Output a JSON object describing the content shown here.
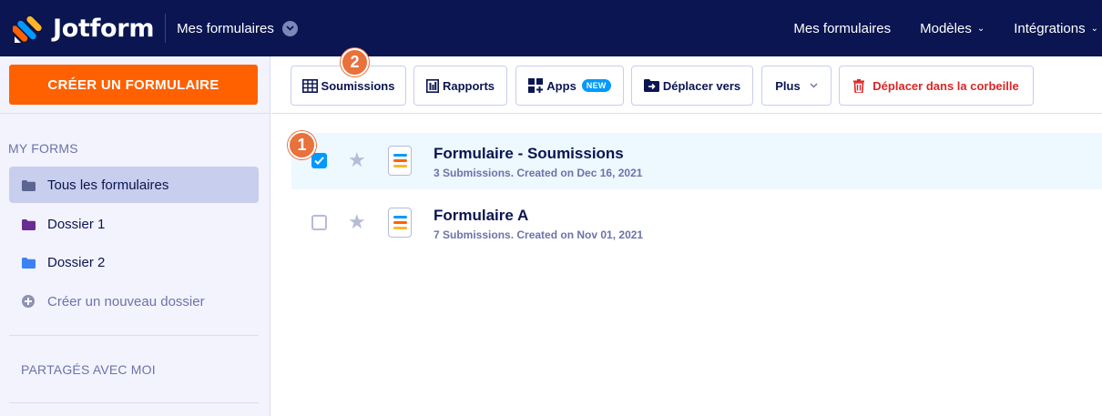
{
  "topbar": {
    "brand": "Jotform",
    "workspace_label": "Mes formulaires",
    "nav": [
      {
        "label": "Mes formulaires",
        "has_chevron": false
      },
      {
        "label": "Modèles",
        "has_chevron": true
      },
      {
        "label": "Intégrations",
        "has_chevron": true
      }
    ]
  },
  "sidebar": {
    "create_button": "CRÉER UN FORMULAIRE",
    "my_forms_title": "MY FORMS",
    "folders": [
      {
        "label": "Tous les formulaires",
        "color": "#5b6590",
        "active": true
      },
      {
        "label": "Dossier 1",
        "color": "#6a2c91",
        "active": false
      },
      {
        "label": "Dossier 2",
        "color": "#3b82f6",
        "active": false
      }
    ],
    "new_folder": "Créer un nouveau dossier",
    "shared_title": "PARTAGÉS AVEC MOI"
  },
  "toolbar": {
    "submissions": "Soumissions",
    "reports": "Rapports",
    "apps": "Apps",
    "apps_badge": "NEW",
    "move_to": "Déplacer vers",
    "more": "Plus",
    "trash": "Déplacer dans la corbeille"
  },
  "steps": {
    "step1": "1",
    "step2": "2"
  },
  "forms": [
    {
      "title": "Formulaire - Soumissions",
      "meta": "3 Submissions. Created on Dec 16, 2021",
      "selected": true
    },
    {
      "title": "Formulaire A",
      "meta": "7 Submissions. Created on Nov 01, 2021",
      "selected": false
    }
  ],
  "colors": {
    "navy": "#0a1551",
    "orange": "#ff6100",
    "accent_blue": "#0099ff",
    "danger": "#dc2626",
    "step_badge": "#e8713c"
  }
}
